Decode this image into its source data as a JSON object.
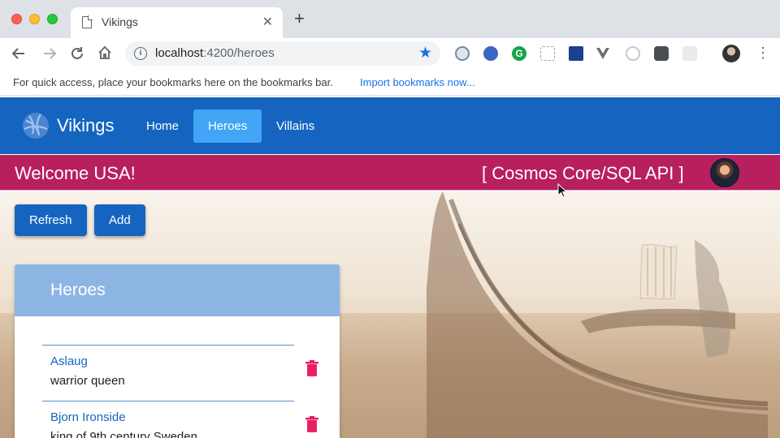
{
  "browser": {
    "tab_title": "Vikings",
    "url_host": "localhost",
    "url_path": ":4200/heroes",
    "bookmarks_message": "For quick access, place your bookmarks here on the bookmarks bar.",
    "bookmarks_link": "Import bookmarks now...",
    "tab_close_glyph": "✕",
    "new_tab_glyph": "+",
    "star_glyph": "★",
    "menu_glyph": "⋮"
  },
  "app": {
    "brand": "Vikings",
    "nav": [
      {
        "label": "Home",
        "active": false
      },
      {
        "label": "Heroes",
        "active": true
      },
      {
        "label": "Villains",
        "active": false
      }
    ],
    "welcome": "Welcome USA!",
    "api_label": "[ Cosmos Core/SQL API ]",
    "actions": {
      "refresh": "Refresh",
      "add": "Add"
    },
    "colors": {
      "header": "#1565c0",
      "nav_active": "#42a5f5",
      "welcome_bar": "#b81f5d",
      "card_header": "#8db5e3",
      "delete": "#e91e63"
    }
  },
  "heroes_card": {
    "title": "Heroes",
    "items": [
      {
        "name": "Aslaug",
        "description": "warrior queen"
      },
      {
        "name": "Bjorn Ironside",
        "description": "king of 9th century Sweden"
      }
    ]
  }
}
